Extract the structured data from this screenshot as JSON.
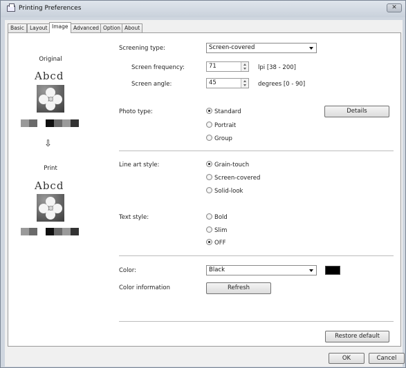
{
  "window": {
    "title": "Printing Preferences",
    "close_icon": "close-icon"
  },
  "tabs": [
    {
      "label": "Basic"
    },
    {
      "label": "Layout"
    },
    {
      "label": "Image",
      "active": true
    },
    {
      "label": "Advanced"
    },
    {
      "label": "Option"
    },
    {
      "label": "About"
    }
  ],
  "preview": {
    "original_title": "Original",
    "original_text": "Abcd",
    "print_title": "Print",
    "print_text": "Abcd",
    "arrow_icon": "arrow-down-icon"
  },
  "screening": {
    "label": "Screening type:",
    "value": "Screen-covered",
    "frequency_label": "Screen frequency:",
    "frequency_value": "71",
    "frequency_unit": "lpi [38 - 200]",
    "angle_label": "Screen angle:",
    "angle_value": "45",
    "angle_unit": "degrees [0 - 90]"
  },
  "photo": {
    "label": "Photo type:",
    "options": [
      "Standard",
      "Portrait",
      "Group"
    ],
    "selected": "Standard",
    "details_button": "Details"
  },
  "lineart": {
    "label": "Line art style:",
    "options": [
      "Grain-touch",
      "Screen-covered",
      "Solid-look"
    ],
    "selected": "Grain-touch"
  },
  "textstyle": {
    "label": "Text style:",
    "options": [
      "Bold",
      "Slim",
      "OFF"
    ],
    "selected": "OFF"
  },
  "color": {
    "label": "Color:",
    "value": "Black",
    "swatch": "#000000",
    "info_label": "Color information",
    "refresh_button": "Refresh"
  },
  "footer": {
    "restore_button": "Restore default",
    "ok_button": "OK",
    "cancel_button": "Cancel"
  }
}
